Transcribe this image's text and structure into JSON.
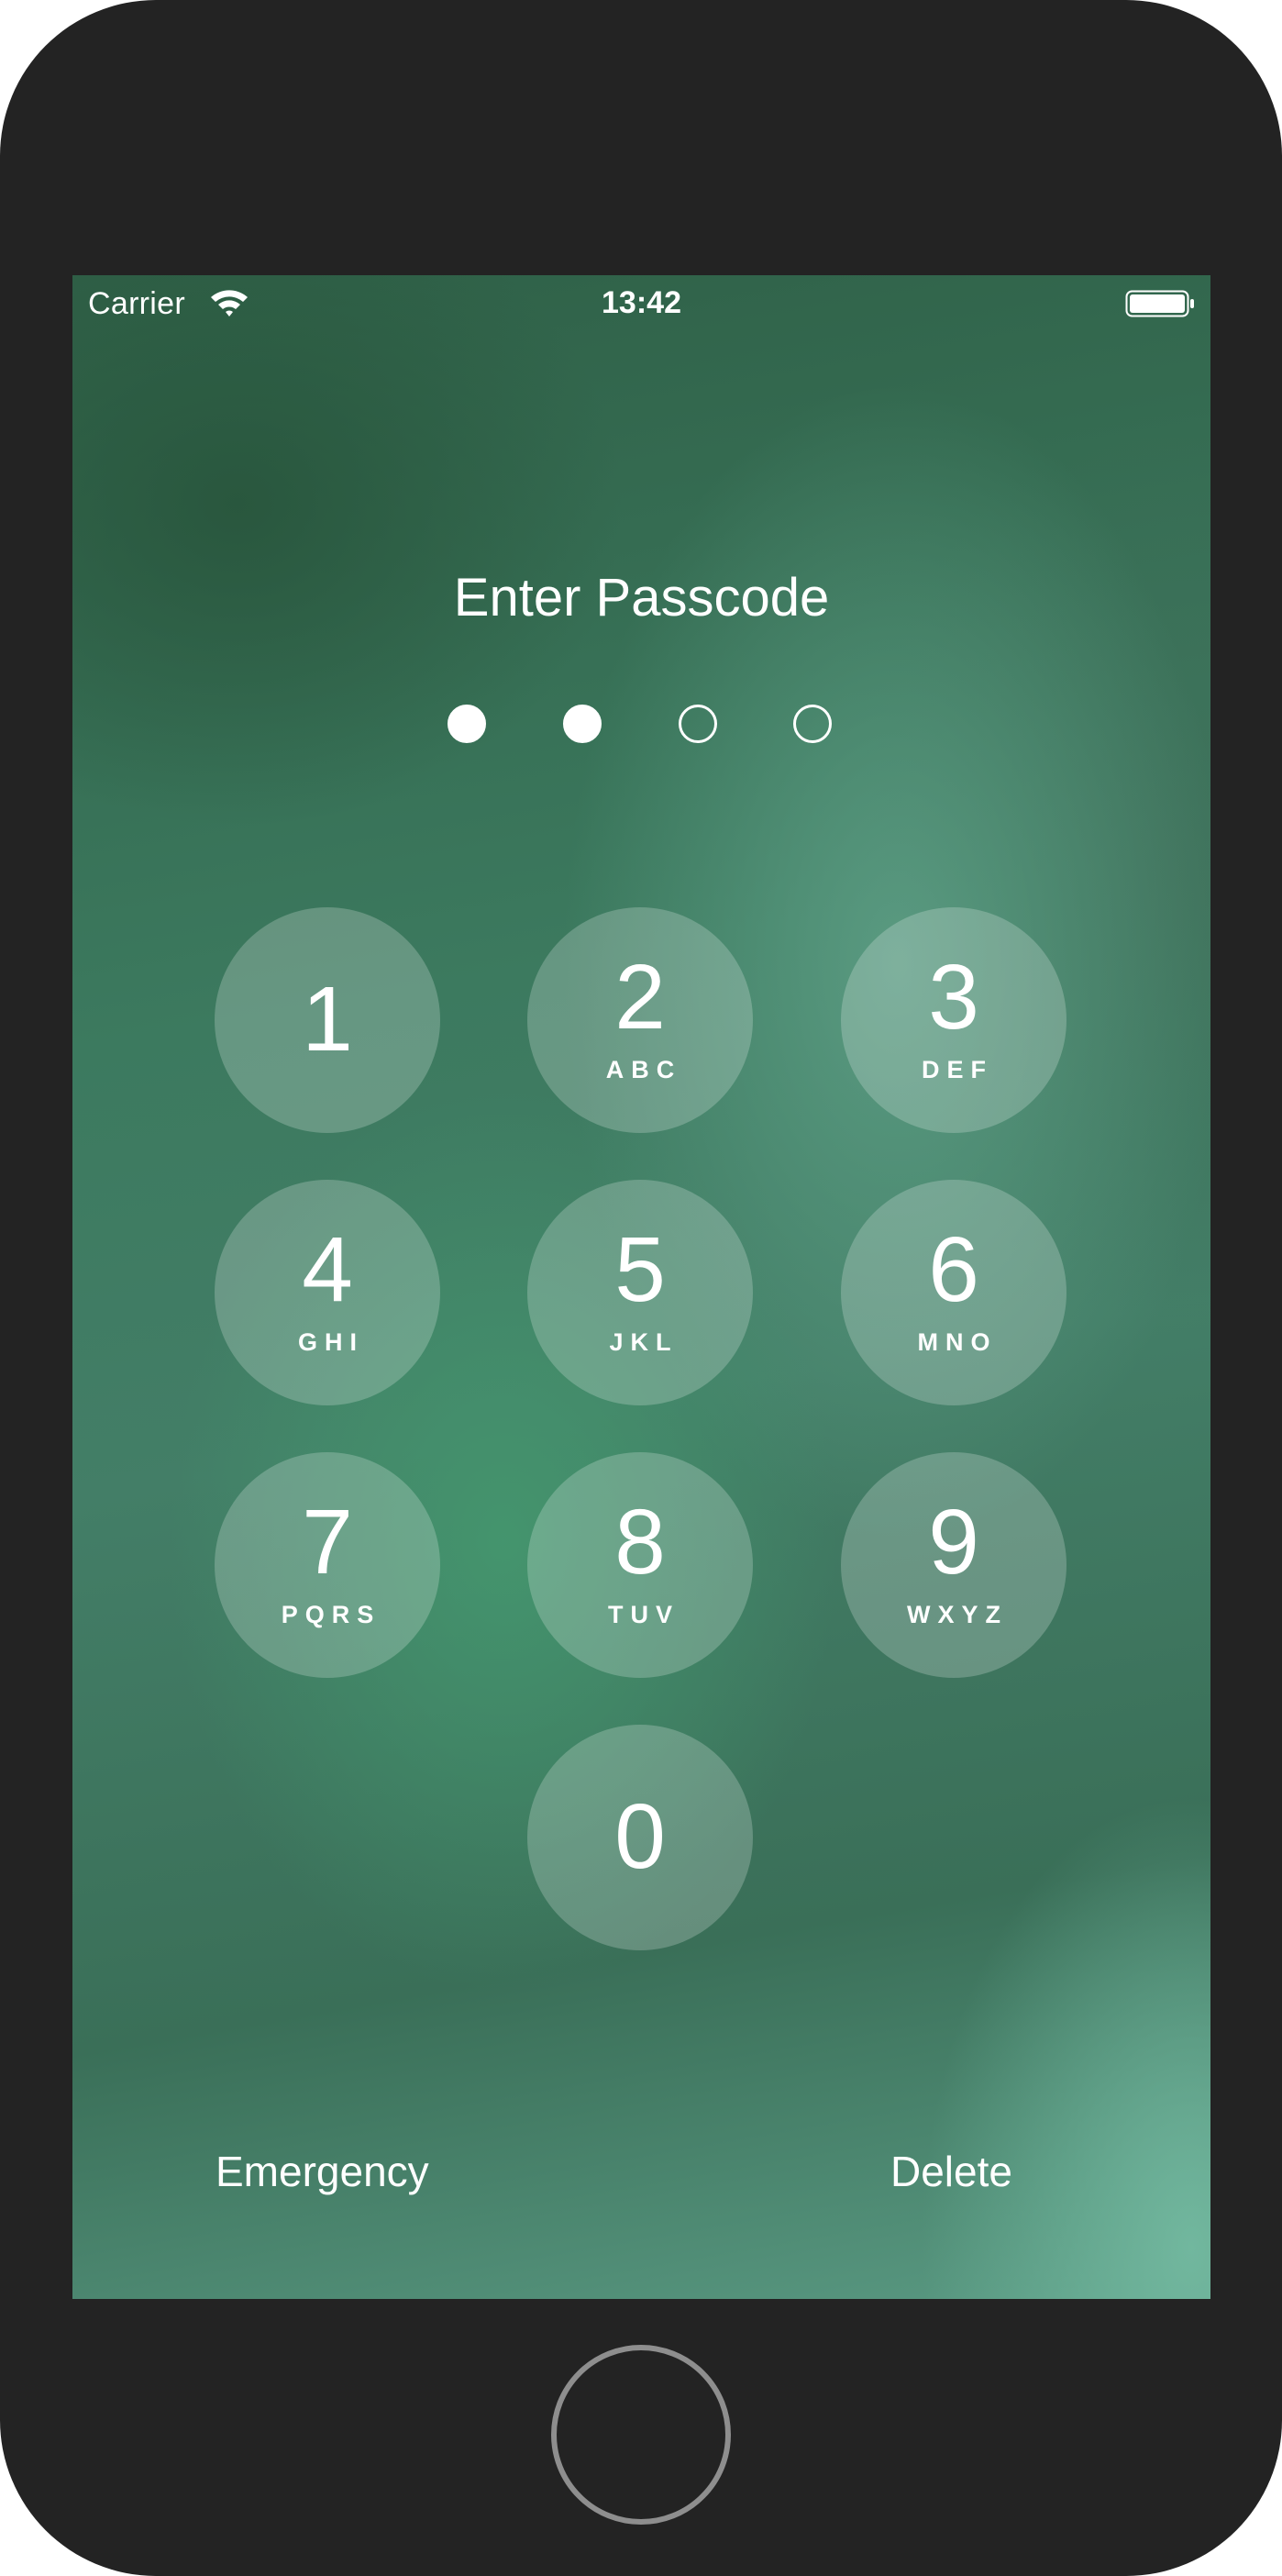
{
  "status_bar": {
    "carrier": "Carrier",
    "time": "13:42",
    "wifi_icon": "wifi-icon",
    "battery_icon": "battery-icon"
  },
  "lock_screen": {
    "title": "Enter Passcode",
    "passcode_length": 4,
    "digits_entered": 2
  },
  "keypad": [
    {
      "digit": "1",
      "letters": ""
    },
    {
      "digit": "2",
      "letters": "ABC"
    },
    {
      "digit": "3",
      "letters": "DEF"
    },
    {
      "digit": "4",
      "letters": "GHI"
    },
    {
      "digit": "5",
      "letters": "JKL"
    },
    {
      "digit": "6",
      "letters": "MNO"
    },
    {
      "digit": "7",
      "letters": "PQRS"
    },
    {
      "digit": "8",
      "letters": "TUV"
    },
    {
      "digit": "9",
      "letters": "WXYZ"
    },
    {
      "digit": "0",
      "letters": ""
    }
  ],
  "actions": {
    "emergency_label": "Emergency",
    "delete_label": "Delete"
  },
  "colors": {
    "device_frame": "#232323",
    "home_button_ring": "#8e8e8e",
    "text": "#ffffff"
  }
}
